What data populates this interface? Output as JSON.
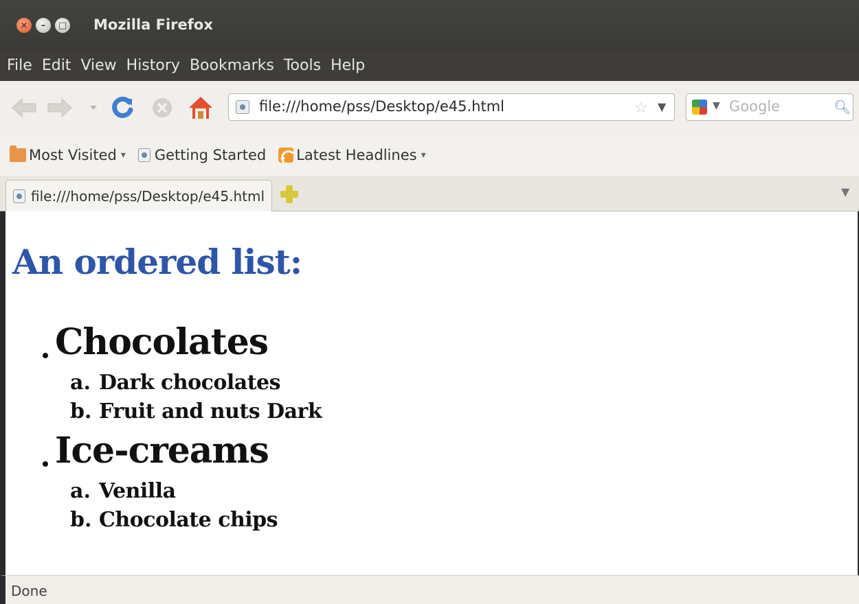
{
  "window": {
    "title": "Mozilla Firefox",
    "buttons": [
      "×",
      "–",
      "□"
    ]
  },
  "menu": [
    "File",
    "Edit",
    "View",
    "History",
    "Bookmarks",
    "Tools",
    "Help"
  ],
  "nav": {
    "url": "file:///home/pss/Desktop/e45.html",
    "search_placeholder": "Google"
  },
  "bookmarks": [
    {
      "label": "Most Visited",
      "icon": "folder-icon",
      "dropdown": "▾"
    },
    {
      "label": "Getting Started",
      "icon": "page-icon"
    },
    {
      "label": "Latest Headlines",
      "icon": "rss-icon",
      "dropdown": "▾"
    }
  ],
  "tabs": [
    {
      "label": "file:///home/pss/Desktop/e45.html"
    }
  ],
  "content": {
    "heading": "An ordered list:",
    "items": [
      {
        "label": "Chocolates",
        "subitems": [
          {
            "marker": "a.",
            "label": "Dark chocolates"
          },
          {
            "marker": "b.",
            "label": "Fruit and nuts Dark"
          }
        ]
      },
      {
        "label": "Ice-creams",
        "subitems": [
          {
            "marker": "a.",
            "label": "Venilla"
          },
          {
            "marker": "b.",
            "label": "Chocolate chips"
          }
        ]
      }
    ]
  },
  "status": "Done",
  "colors": {
    "heading": "#2e56a8",
    "titlebar": "#3e3d39",
    "toolbar": "#f1efeb"
  }
}
